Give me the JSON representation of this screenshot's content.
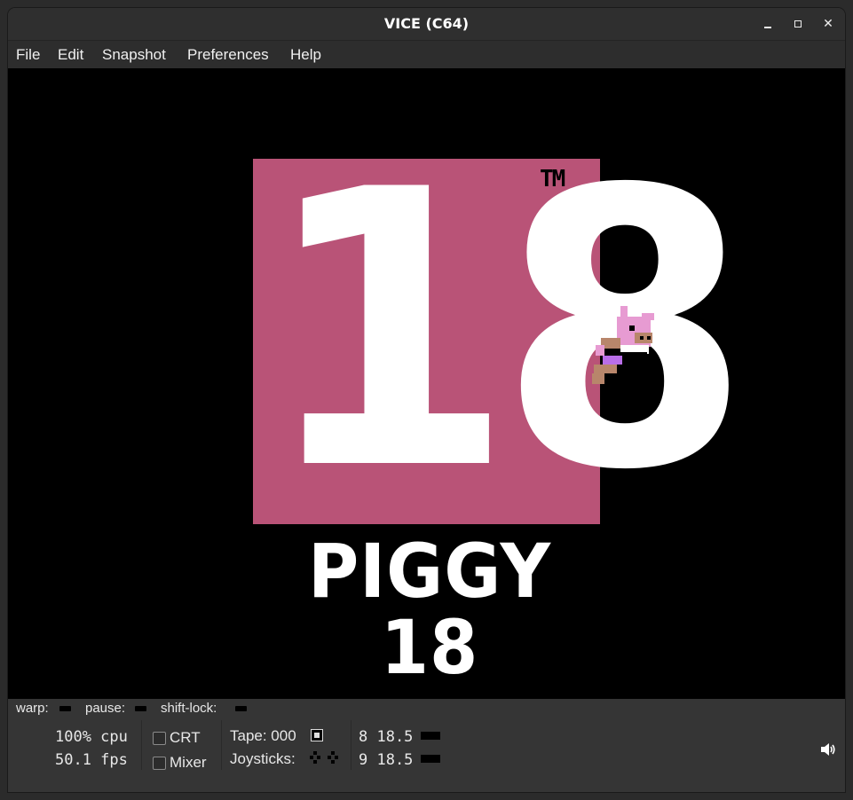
{
  "window": {
    "title": "VICE (C64)"
  },
  "menu": {
    "items": [
      "File",
      "Edit",
      "Snapshot",
      "Preferences",
      "Help"
    ]
  },
  "screen": {
    "big_text": "18",
    "trademark": "TM",
    "game_title": "PIGGY 18"
  },
  "status": {
    "warp_label": "warp:",
    "pause_label": "pause:",
    "shift_lock_label": "shift-lock:",
    "cpu": "100% cpu",
    "fps": "50.1 fps",
    "crt_label": "CRT",
    "mixer_label": "Mixer",
    "tape_label": "Tape: 000",
    "joysticks_label": "Joysticks:",
    "drive8": "8 18.5",
    "drive9": "9 18.5"
  },
  "colors": {
    "logo_pink": "#b95377",
    "screen_bg": "#000000",
    "titlebar": "#2f2f2f"
  },
  "icons": [
    "minimize-icon",
    "maximize-icon",
    "close-icon",
    "speaker-icon"
  ]
}
